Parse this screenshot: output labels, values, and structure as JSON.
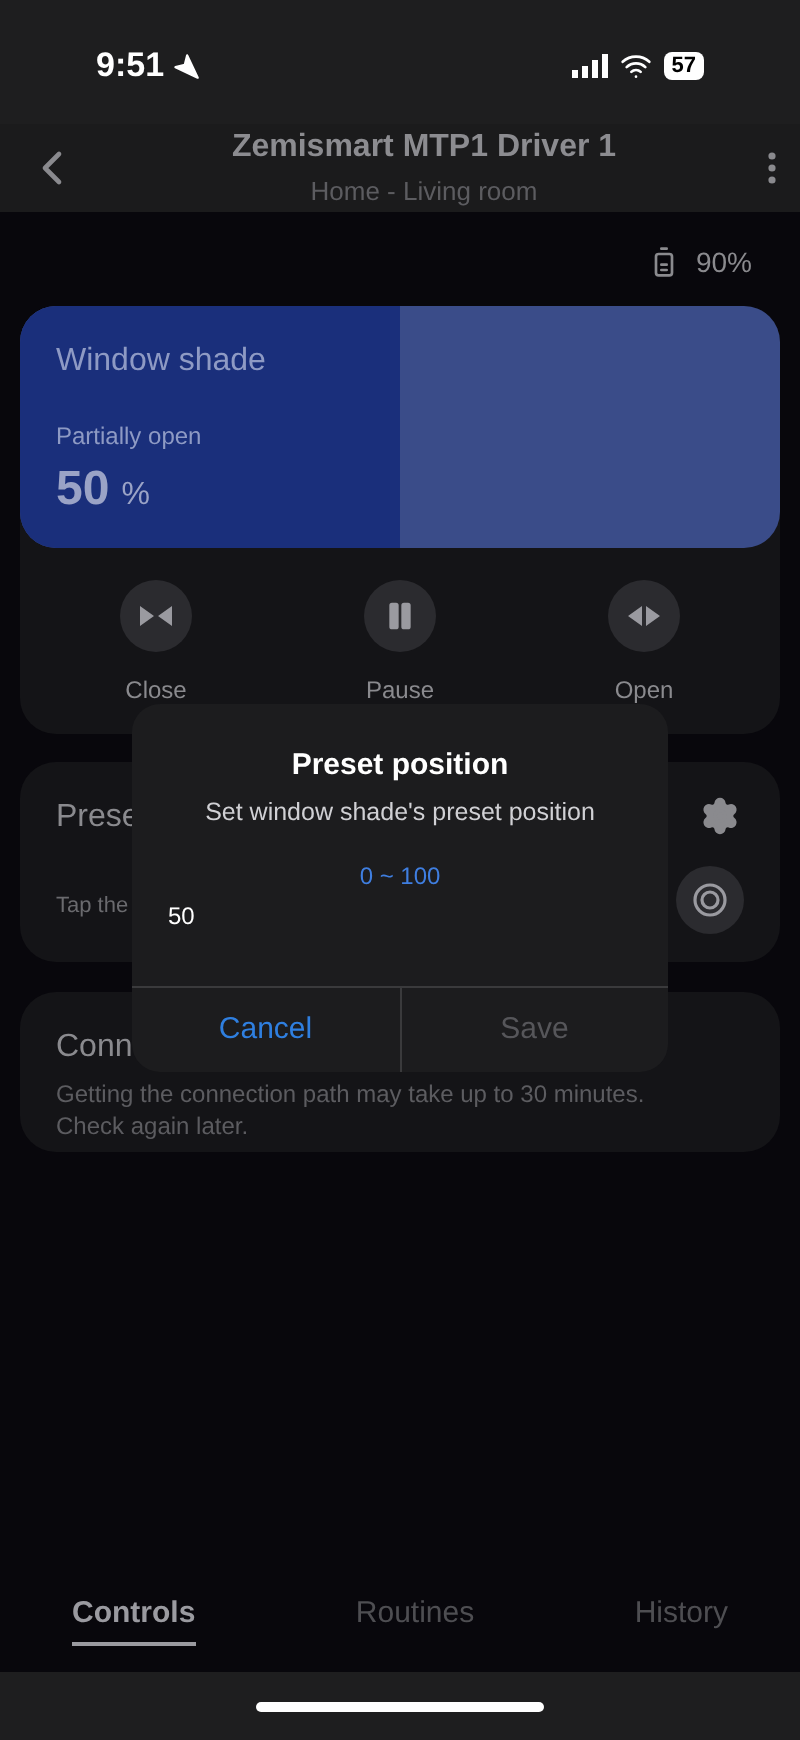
{
  "status_bar": {
    "time": "9:51",
    "battery": "57"
  },
  "header": {
    "title": "Zemismart MTP1 Driver 1",
    "subtitle": "Home - Living room"
  },
  "device_battery": "90%",
  "shade": {
    "title": "Window shade",
    "state": "Partially open",
    "value": "50",
    "unit": "%",
    "level": 0.5
  },
  "controls": [
    {
      "kind": "close",
      "label": "Close"
    },
    {
      "kind": "pause",
      "label": "Pause"
    },
    {
      "kind": "open",
      "label": "Open"
    }
  ],
  "preset_card": {
    "title": "Prese",
    "hint": "Tap the"
  },
  "connection_card": {
    "title": "Conn",
    "text": "Getting the connection path may take up to 30 minutes.",
    "text2": "Check again later."
  },
  "dialog": {
    "title": "Preset position",
    "subtitle": "Set window shade's preset position",
    "range": "0 ~ 100",
    "value": "50",
    "buttons": [
      {
        "label": "Cancel",
        "disabled": false
      },
      {
        "label": "Save",
        "disabled": true
      }
    ]
  },
  "tabs": [
    {
      "label": "Controls",
      "selected": true
    },
    {
      "label": "Routines",
      "selected": false
    },
    {
      "label": "History",
      "selected": false
    }
  ]
}
